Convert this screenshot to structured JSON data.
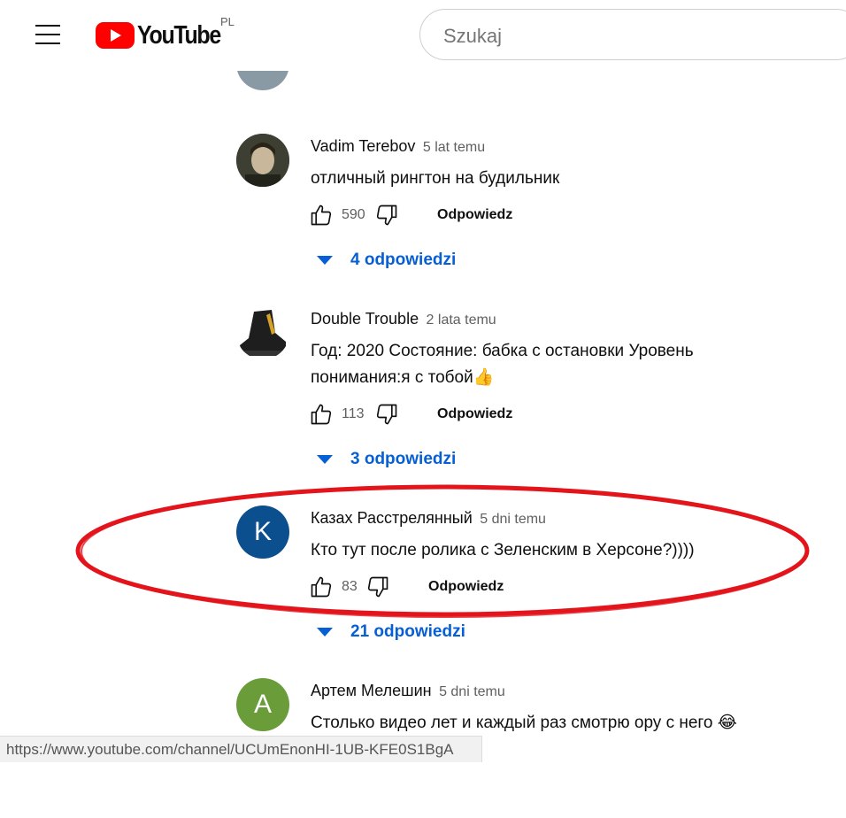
{
  "header": {
    "logo_text": "YouTube",
    "country_code": "PL",
    "search_placeholder": "Szukaj"
  },
  "comments": [
    {
      "author": "Vadim Terebov",
      "time": "5 lat temu",
      "text": "отличный рингтон на будильник",
      "likes": "590",
      "reply_label": "Odpowiedz",
      "replies_label": "4 odpowiedzi"
    },
    {
      "author": "Double Trouble",
      "time": "2 lata temu",
      "text": "Год: 2020 Состояние: бабка с остановки Уровень понимания:я с тобой👍",
      "likes": "113",
      "reply_label": "Odpowiedz",
      "replies_label": "3 odpowiedzi"
    },
    {
      "author": "Казах Расстрелянный",
      "time": "5 dni temu",
      "text": "Кто тут после ролика с Зеленским в Херсоне?))))",
      "likes": "83",
      "reply_label": "Odpowiedz",
      "replies_label": "21 odpowiedzi",
      "avatar_letter": "K",
      "avatar_color": "#0b4f8f"
    },
    {
      "author": "Артем Мелешин",
      "time": "5 dni temu",
      "text": "Столько видео лет и каждый раз смотрю ору с него 😂",
      "avatar_letter": "A",
      "avatar_color": "#6a9d3a"
    }
  ],
  "status_bar": {
    "url": "https://www.youtube.com/channel/UCUmEnonHI-1UB-KFE0S1BgA"
  },
  "colors": {
    "accent_blue": "#065fd4",
    "logo_red": "#ff0000",
    "annotation_red": "#e3141b"
  }
}
